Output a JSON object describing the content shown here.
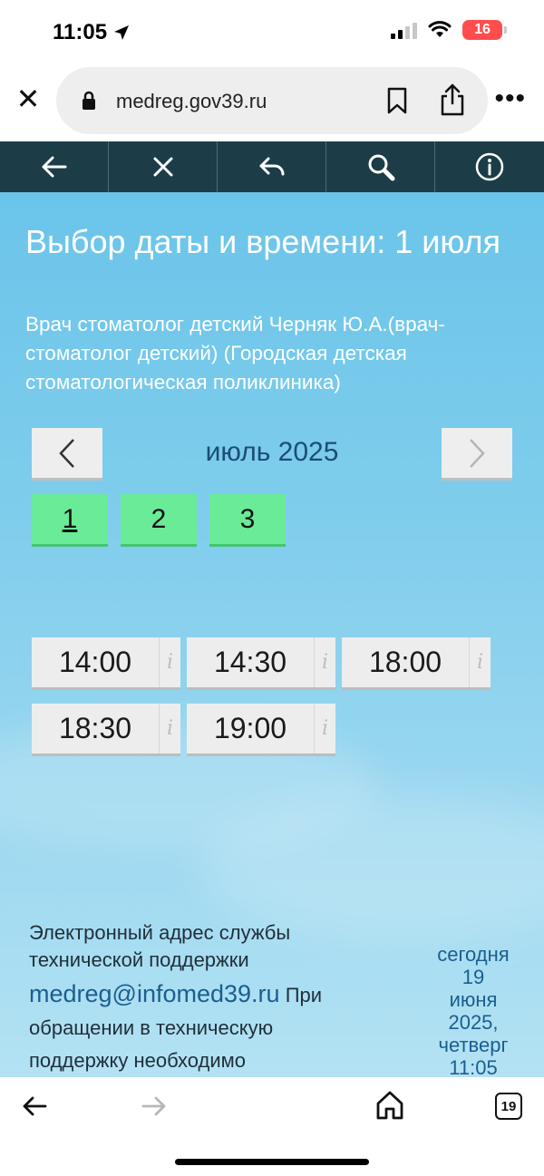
{
  "status_bar": {
    "time": "11:05",
    "battery": "16"
  },
  "browser": {
    "url": "medreg.gov39.ru",
    "tab_count": "19"
  },
  "page": {
    "title": "Выбор даты и времени: 1 июля",
    "subtitle": "Врач стоматолог детский Черняк Ю.А.(врач-стоматолог детский) (Городская детская стоматологическая поликлиника)",
    "month": "июль 2025",
    "days": [
      "1",
      "2",
      "3"
    ],
    "selected_day": "1",
    "time_slots": [
      {
        "time": "14:00",
        "info": "i"
      },
      {
        "time": "14:30",
        "info": "i"
      },
      {
        "time": "18:00",
        "info": "i"
      },
      {
        "time": "18:30",
        "info": "i"
      },
      {
        "time": "19:00",
        "info": "i"
      }
    ],
    "support": {
      "text": "Электронный адрес службы технической поддержки",
      "email": "medreg@infomed39.ru",
      "continuation_1": "При обращении в техническую",
      "continuation_2": "поддержку необходимо"
    },
    "today": {
      "label": "сегодня",
      "day": "19",
      "month": "июня",
      "year": "2025,",
      "weekday": "четверг",
      "time": "11:05"
    }
  },
  "colors": {
    "toolbar": "#1c3d47",
    "day_button": "#69eb98",
    "slot_button": "#ededed",
    "link": "#1b5e8f"
  },
  "icons": {
    "toolbar": [
      "arrow-left-icon",
      "close-icon",
      "reply-icon",
      "search-icon",
      "info-icon"
    ],
    "bottom": [
      "back-icon",
      "forward-icon",
      "home-icon",
      "tabs-icon"
    ]
  }
}
